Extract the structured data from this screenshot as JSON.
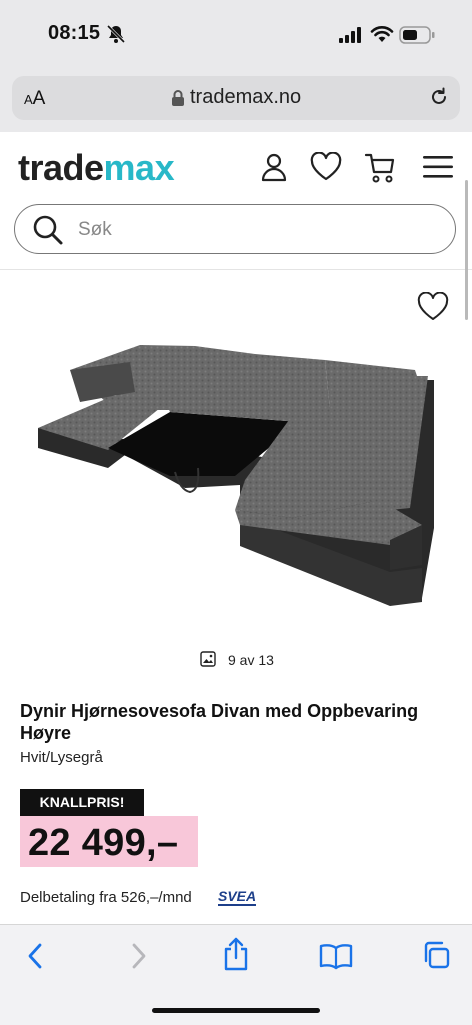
{
  "status_bar": {
    "time": "08:15"
  },
  "browser": {
    "aa": "A",
    "aa_big": "A",
    "url": "trademax.no"
  },
  "site": {
    "logo_part1": "trade",
    "logo_part2": "max"
  },
  "search": {
    "placeholder": "Søk"
  },
  "product": {
    "image_counter": "9 av 13",
    "title": "Dynir Hjørnesovesofa Divan med Oppbevaring Høyre",
    "variant": "Hvit/Lysegrå",
    "badge": "KNALLPRIS!",
    "price": "22 499,–",
    "installment": "Delbetaling fra 526,–/mnd",
    "payment_brand": "SVEA"
  },
  "colors": {
    "brand": "#28b8c8",
    "price_highlight": "#f8c7d9",
    "badge_bg": "#111111"
  },
  "icons": [
    "bell-slash-icon",
    "signal-icon",
    "wifi-icon",
    "battery-icon",
    "lock-icon",
    "reload-icon",
    "user-icon",
    "heart-icon",
    "cart-icon",
    "menu-icon",
    "search-icon",
    "favorite-icon",
    "gallery-icon",
    "back-icon",
    "forward-icon",
    "share-icon",
    "bookmarks-icon",
    "tabs-icon"
  ]
}
